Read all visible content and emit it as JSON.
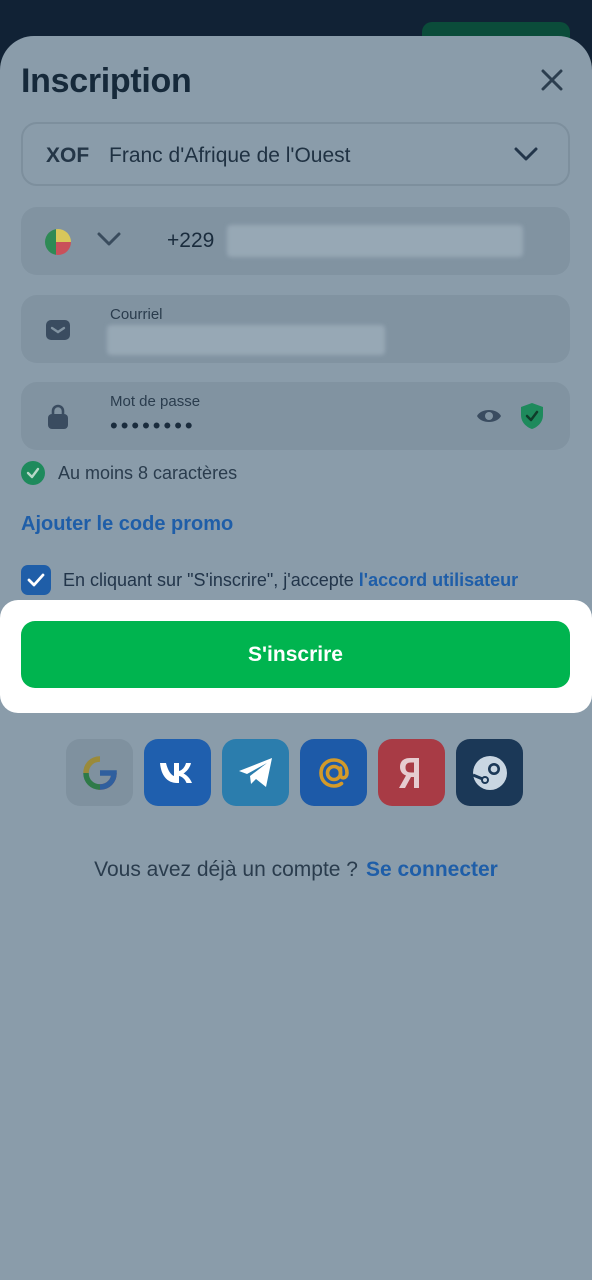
{
  "header": {
    "title": "Inscription"
  },
  "currency": {
    "code": "XOF",
    "name": "Franc d'Afrique de l'Ouest"
  },
  "phone": {
    "prefix": "+229",
    "flag_icon": "benin-flag-icon"
  },
  "email": {
    "label": "Courriel"
  },
  "password": {
    "label": "Mot de passe",
    "masked_value": "••••••••"
  },
  "password_rule": {
    "text": "Au moins 8 caractères",
    "status_color": "#1e8a5c"
  },
  "promo": {
    "label": "Ajouter le code promo"
  },
  "agreement": {
    "text": "En cliquant sur \"S'inscrire\", j'accepte ",
    "link": "l'accord utilisateur",
    "checked": true
  },
  "submit": {
    "label": "S'inscrire",
    "color": "#00b44f"
  },
  "social_buttons": [
    {
      "name": "google",
      "icon": "google-icon"
    },
    {
      "name": "vk",
      "icon": "vk-icon"
    },
    {
      "name": "telegram",
      "icon": "telegram-icon"
    },
    {
      "name": "mailru",
      "icon": "mail-at-icon"
    },
    {
      "name": "yandex",
      "icon": "yandex-icon"
    },
    {
      "name": "steam",
      "icon": "steam-icon"
    }
  ],
  "login_prompt": {
    "text": "Vous avez déjà un compte ?",
    "link": "Se connecter"
  },
  "colors": {
    "accent": "#1f5ea8",
    "overlay": "#8a9caa"
  }
}
